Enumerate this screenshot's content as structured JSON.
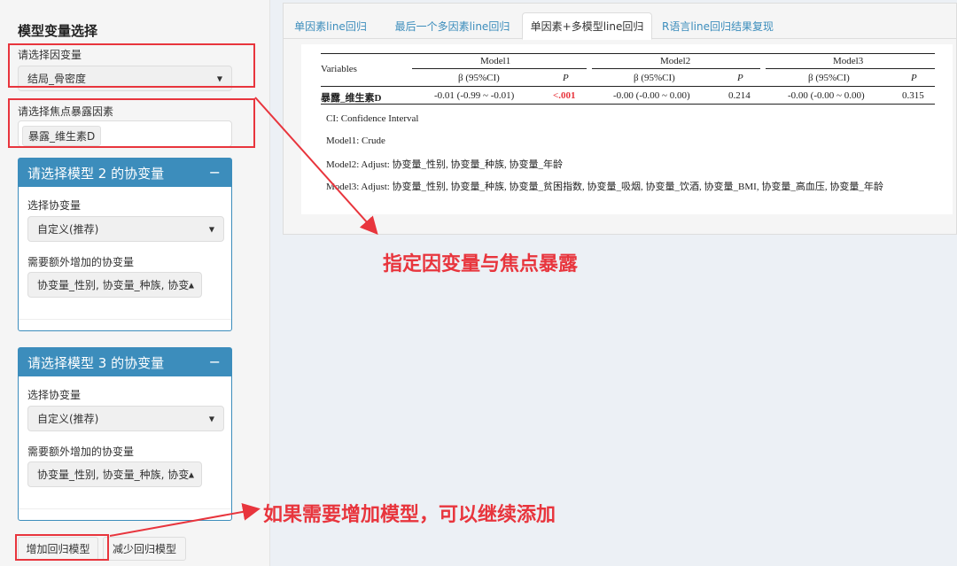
{
  "sidebar": {
    "title": "模型变量选择",
    "dependent_label": "请选择因变量",
    "dependent_value": "结局_骨密度",
    "exposure_label": "请选择焦点暴露因素",
    "exposure_token": "暴露_维生素D",
    "boxes": [
      {
        "title": "请选择模型 2 的协变量",
        "covar_label": "选择协变量",
        "covar_value": "自定义(推荐)",
        "extra_label": "需要额外增加的协变量",
        "extra_value": "协变量_性别, 协变量_种族, 协变"
      },
      {
        "title": "请选择模型 3 的协变量",
        "covar_label": "选择协变量",
        "covar_value": "自定义(推荐)",
        "extra_label": "需要额外增加的协变量",
        "extra_value": "协变量_性别, 协变量_种族, 协变"
      }
    ],
    "add_button": "增加回归模型",
    "remove_button": "减少回归模型"
  },
  "tabs": [
    "单因素line回归",
    "最后一个多因素line回归",
    "单因素+多模型line回归",
    "R语言line回归结果复现"
  ],
  "table": {
    "variables_header": "Variables",
    "models": [
      "Model1",
      "Model2",
      "Model3"
    ],
    "beta_header": "β (95%CI)",
    "p_header": "P",
    "row": {
      "name": "暴露_维生素D",
      "m1_beta": "-0.01 (-0.99 ~ -0.01)",
      "m1_p": "<.001",
      "m2_beta": "-0.00 (-0.00 ~ 0.00)",
      "m2_p": "0.214",
      "m3_beta": "-0.00 (-0.00 ~ 0.00)",
      "m3_p": "0.315"
    },
    "notes": [
      "CI: Confidence Interval",
      "Model1: Crude",
      "Model2: Adjust: 协变量_性别, 协变量_种族, 协变量_年龄",
      "Model3: Adjust: 协变量_性别, 协变量_种族, 协变量_贫困指数, 协变量_吸烟, 协变量_饮酒, 协变量_BMI, 协变量_高血压, 协变量_年龄"
    ]
  },
  "annotations": {
    "callout1": "指定因变量与焦点暴露",
    "callout2": "如果需要增加模型，可以继续添加"
  },
  "colors": {
    "accent": "#3c8dbc",
    "annotation": "#e8353d"
  }
}
